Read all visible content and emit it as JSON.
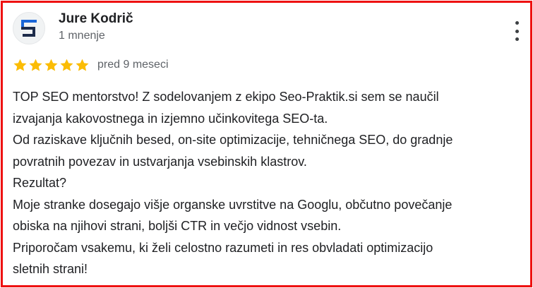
{
  "review": {
    "author_name": "Jure Kodrič",
    "review_count": "1 mnenje",
    "rating": 5,
    "rating_max": 5,
    "date": "pred 9 meseci",
    "text_lines": [
      "TOP SEO mentorstvo! Z sodelovanjem z ekipo Seo-Praktik.si sem se naučil",
      "izvajanja kakovostnega in izjemno učinkovitega SEO-ta.",
      "Od raziskave ključnih besed, on-site optimizacije, tehničnega SEO, do gradnje",
      "povratnih povezav in ustvarjanja vsebinskih klastrov.",
      "Rezultat?",
      "Moje stranke dosegajo višje organske uvrstitve na Googlu, občutno povečanje",
      "obiska na njihovi strani, boljši CTR in večjo vidnost vsebin.",
      "Priporočam vsakemu, ki želi celostno razumeti in res obvladati optimizacijo",
      "sletnih strani!"
    ]
  },
  "icons": {
    "avatar": "seo-logo-icon",
    "star": "star-icon",
    "more": "more-vertical-icon"
  },
  "colors": {
    "highlight_border": "#ee1111",
    "star": "#fbbc04",
    "logo_blue": "#1a66d8",
    "logo_dark": "#1d2b4a",
    "text_primary": "#202124",
    "text_secondary": "#5f6368"
  }
}
